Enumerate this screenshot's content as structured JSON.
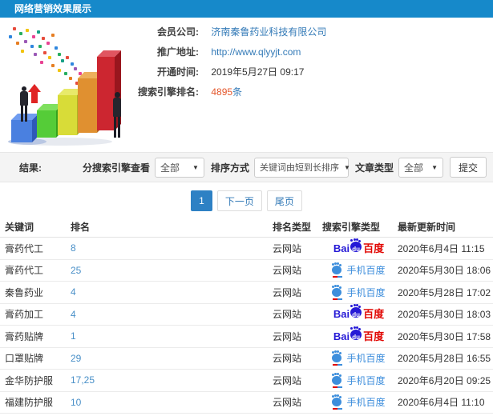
{
  "header": {
    "title": "网络营销效果展示"
  },
  "info": {
    "company_label": "会员公司:",
    "company_value": "济南秦鲁药业科技有限公司",
    "site_label": "推广地址:",
    "site_value": "http://www.qlyyjt.com",
    "opened_label": "开通时间:",
    "opened_value": "2019年5月27日 09:17",
    "rank_label": "搜索引擎排名:",
    "rank_count": "4895",
    "rank_unit": "条"
  },
  "filters": {
    "result_label": "结果:",
    "engine_view_label": "分搜索引擎查看",
    "engine_view_value": "全部",
    "sort_label": "排序方式",
    "sort_value": "关键词由短到长排序",
    "article_type_label": "文章类型",
    "article_type_value": "全部",
    "submit_label": "提交",
    "caret": "▼"
  },
  "pagination": {
    "current": "1",
    "next_label": "下一页",
    "last_label": "尾页"
  },
  "table": {
    "headers": [
      "关键词",
      "排名",
      "排名类型",
      "搜索引擎类型",
      "最新更新时间"
    ],
    "rows": [
      {
        "keyword": "膏药代工",
        "rank": "8",
        "rank_type": "云网站",
        "engine": "baidu",
        "engine_label": "百度",
        "updated": "2020年6月4日 11:15"
      },
      {
        "keyword": "膏药代工",
        "rank": "25",
        "rank_type": "云网站",
        "engine": "mobile",
        "engine_label": "手机百度",
        "updated": "2020年5月30日 18:06"
      },
      {
        "keyword": "秦鲁药业",
        "rank": "4",
        "rank_type": "云网站",
        "engine": "mobile",
        "engine_label": "手机百度",
        "updated": "2020年5月28日 17:02"
      },
      {
        "keyword": "膏药加工",
        "rank": "4",
        "rank_type": "云网站",
        "engine": "baidu",
        "engine_label": "百度",
        "updated": "2020年5月30日 18:03"
      },
      {
        "keyword": "膏药贴牌",
        "rank": "1",
        "rank_type": "云网站",
        "engine": "baidu",
        "engine_label": "百度",
        "updated": "2020年5月30日 17:58"
      },
      {
        "keyword": "口罩贴牌",
        "rank": "29",
        "rank_type": "云网站",
        "engine": "mobile",
        "engine_label": "手机百度",
        "updated": "2020年5月28日 16:55"
      },
      {
        "keyword": "金华防护服",
        "rank": "17,25",
        "rank_type": "云网站",
        "engine": "mobile",
        "engine_label": "手机百度",
        "updated": "2020年6月20日 09:25"
      },
      {
        "keyword": "福建防护服",
        "rank": "10",
        "rank_type": "云网站",
        "engine": "mobile",
        "engine_label": "手机百度",
        "updated": "2020年6月4日 11:10"
      }
    ]
  },
  "logos": {
    "baidu_bai": "Bai",
    "baidu_du": "du",
    "baidu_cn": "百度",
    "mobile_label": "手机百度"
  },
  "colors": {
    "titlebar_blue": "#1689ca",
    "link_blue": "#337ab7",
    "count_red": "#e4572c",
    "rank_blue": "#4a90c8",
    "baidu_blue": "#2519d6",
    "baidu_red": "#e10602",
    "mobile_blue": "#3d8edc",
    "active_page_blue": "#2e81c4",
    "filter_bar_bg": "#f4f4f4"
  }
}
